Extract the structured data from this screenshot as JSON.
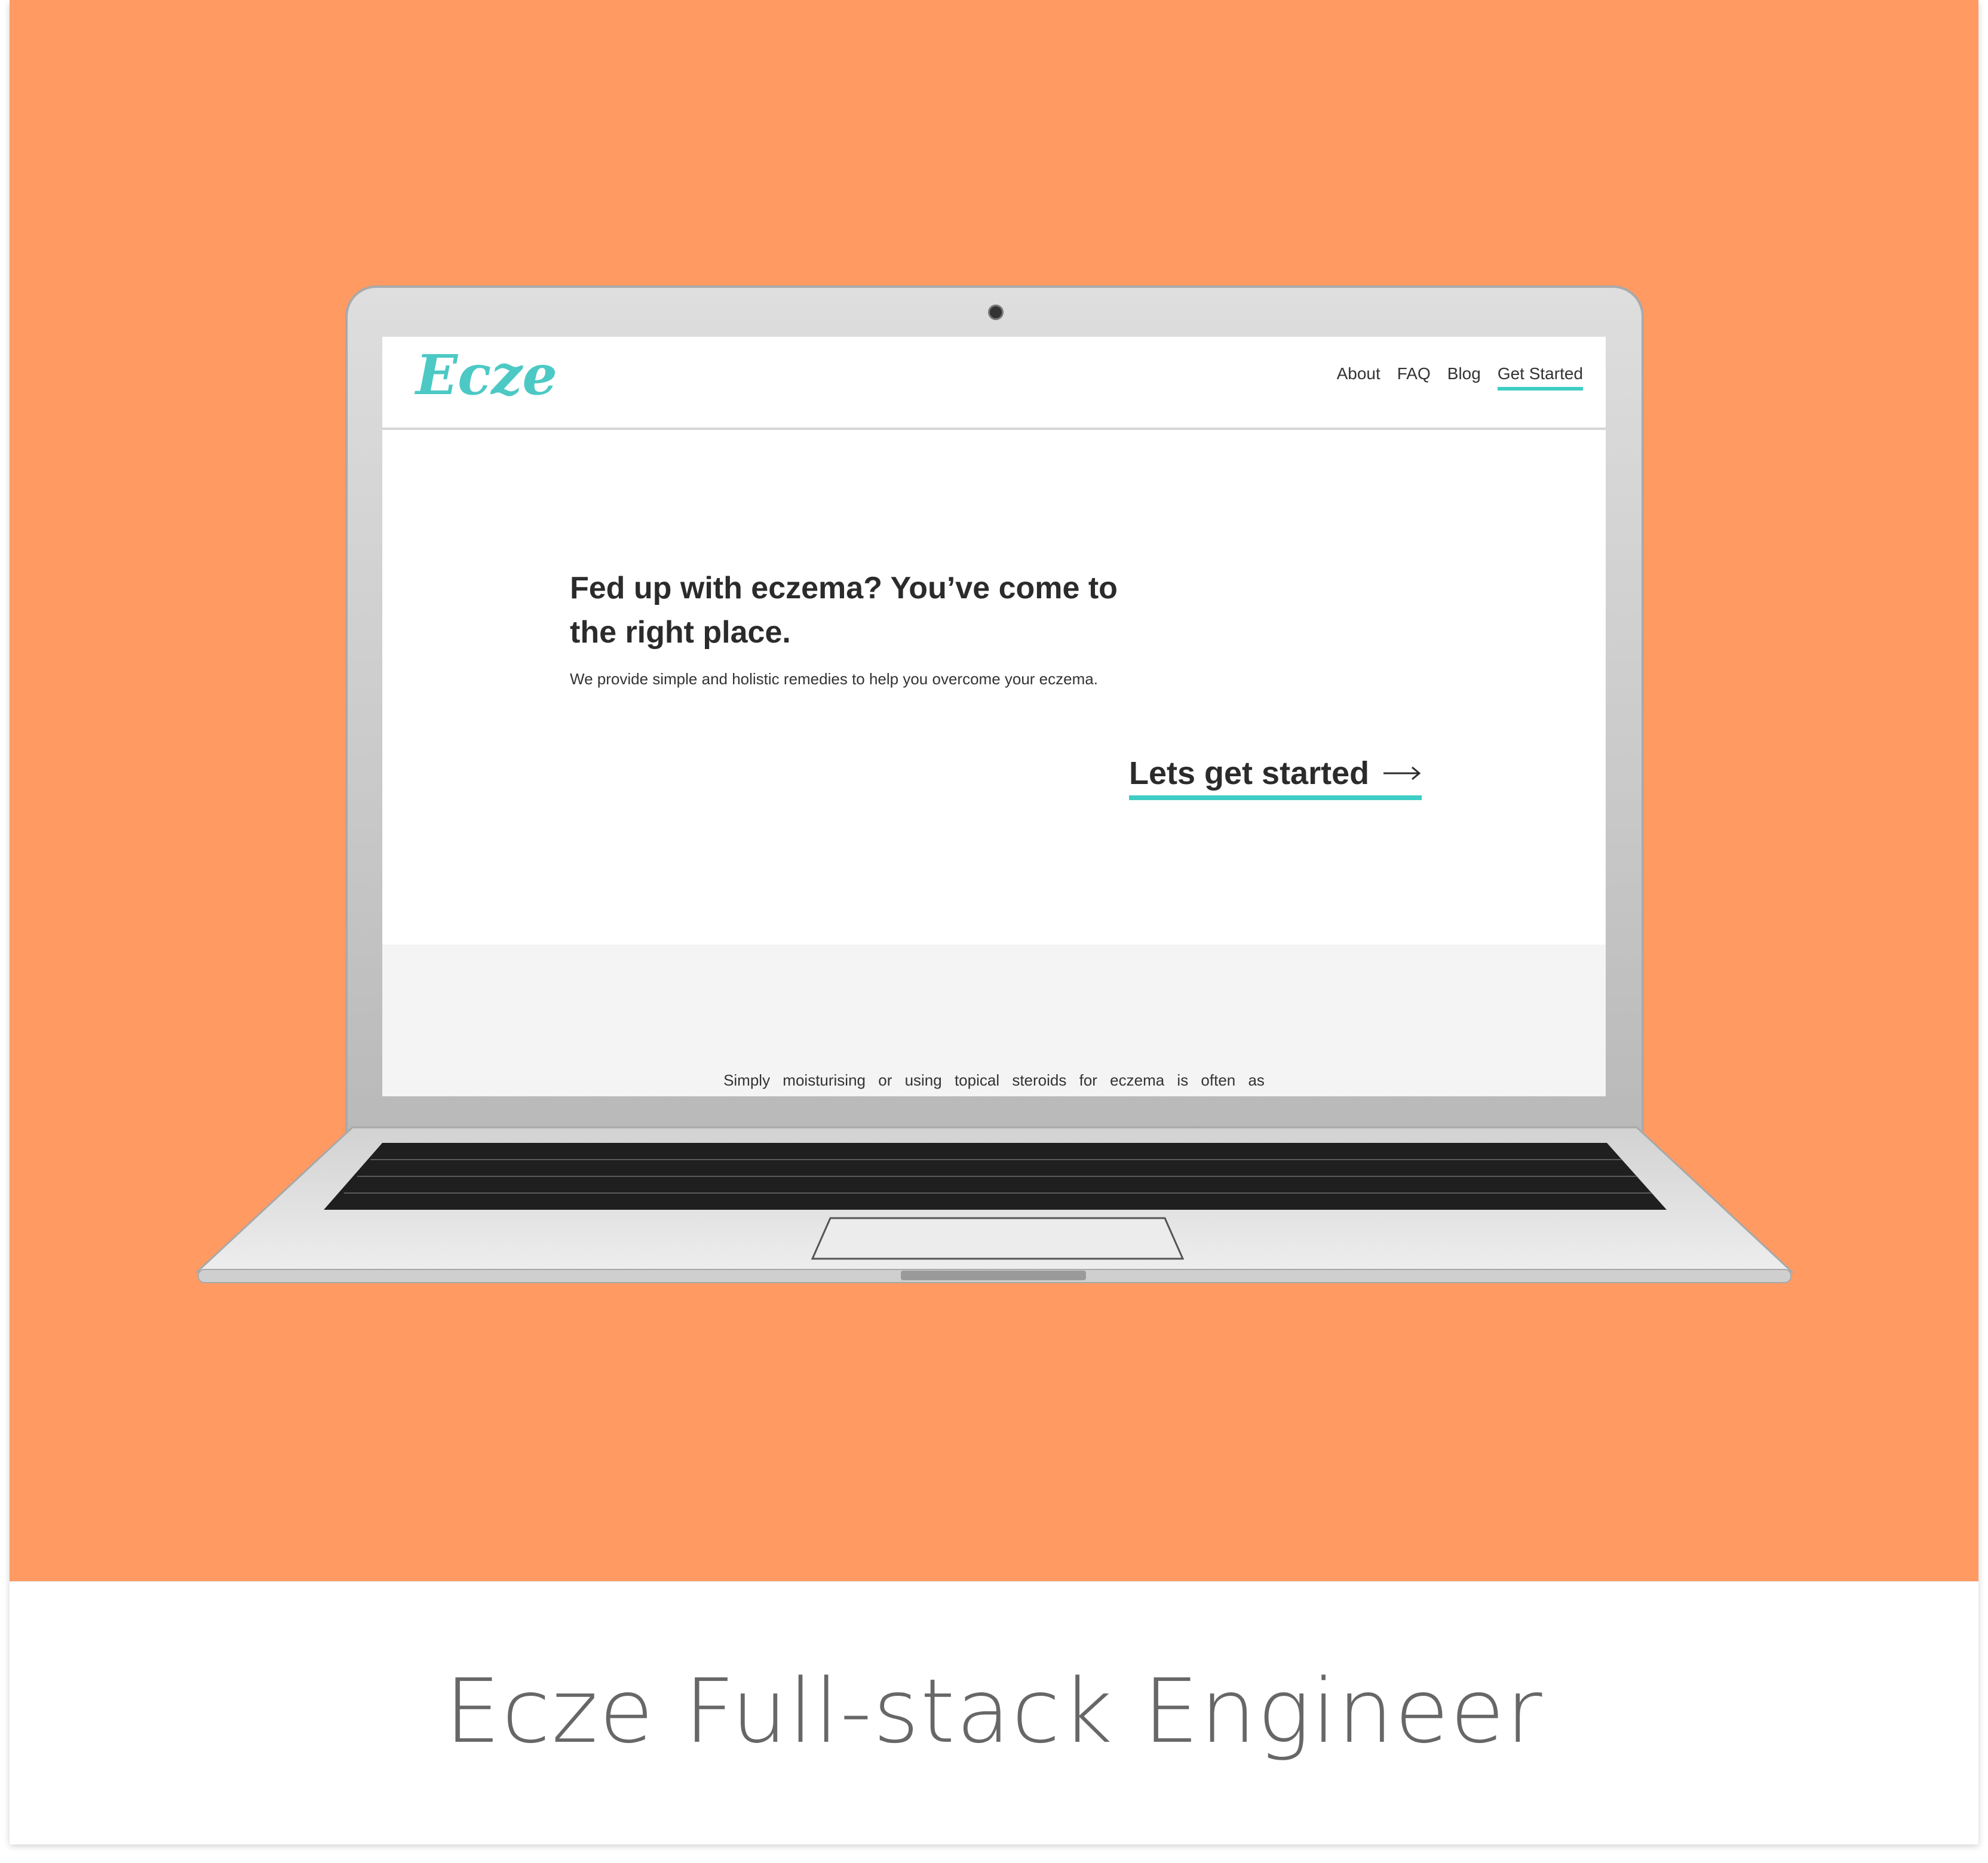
{
  "caption": "Ecze Full-stack Engineer",
  "colors": {
    "background": "#ff9a62",
    "accent": "#3fcdc5",
    "logo": "#4cc9c4"
  },
  "site": {
    "logo": "Ecze",
    "nav": [
      {
        "label": "About"
      },
      {
        "label": "FAQ"
      },
      {
        "label": "Blog"
      },
      {
        "label": "Get Started",
        "active": true
      }
    ],
    "hero": {
      "title": "Fed up with eczema? You’ve come to the right place.",
      "subtitle": "We provide simple and holistic remedies to help you overcome your eczema.",
      "cta_label": "Lets get started",
      "cta_icon": "arrow-right-icon"
    },
    "band_text": "Simply moisturising or using topical steroids for eczema is often as"
  }
}
